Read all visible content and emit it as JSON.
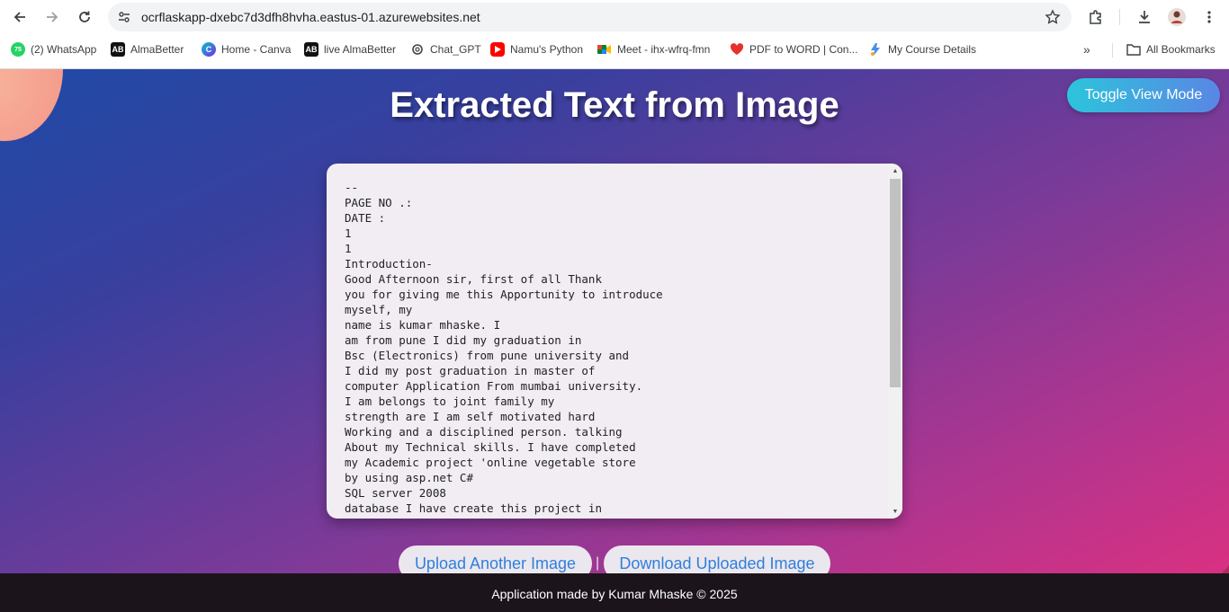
{
  "browser": {
    "url": "ocrflaskapp-dxebc7d3dfh8hvha.eastus-01.azurewebsites.net",
    "bookmarks": [
      {
        "label": "(2) WhatsApp",
        "icon": "whatsapp-icon",
        "badge": "75"
      },
      {
        "label": "AlmaBetter",
        "icon": "almabetter-icon",
        "badge": "AB"
      },
      {
        "label": "Home - Canva",
        "icon": "canva-icon",
        "badge": "C"
      },
      {
        "label": "live AlmaBetter",
        "icon": "almabetter-icon",
        "badge": "AB"
      },
      {
        "label": "Chat_GPT",
        "icon": "chatgpt-icon",
        "badge": ""
      },
      {
        "label": "Namu's Python",
        "icon": "youtube-icon",
        "badge": ""
      },
      {
        "label": "Meet - ihx-wfrq-fmn",
        "icon": "meet-icon",
        "badge": ""
      },
      {
        "label": "PDF to WORD | Con...",
        "icon": "heart-icon",
        "badge": ""
      },
      {
        "label": "My Course Details",
        "icon": "course-icon",
        "badge": ""
      }
    ],
    "all_bookmarks_label": "All Bookmarks"
  },
  "page": {
    "title": "Extracted Text from Image",
    "toggle_label": "Toggle View Mode",
    "extracted_text": "--\nPAGE NO .:\nDATE :\n1\n1\nIntroduction-\nGood Afternoon sir, first of all Thank\nyou for giving me this Apportunity to introduce\nmyself, my\nname is kumar mhaske. I\nam from pune I did my graduation in\nBsc (Electronics) from pune university and\nI did my post graduation in master of\ncomputer Application From mumbai university.\nI am belongs to joint family my\nstrength are I am self motivated hard\nWorking and a disciplined person. talking\nAbout my Technical skills. I have completed\nmy Academic project 'online vegetable store\nby using asp.net C#\nSQL server 2008\ndatabase I have create this project in",
    "upload_label": "Upload Another Image",
    "separator": "|",
    "download_label": "Download Uploaded Image",
    "footer": "Application made by Kumar Mhaske © 2025"
  },
  "colors": {
    "toggle_gradient": [
      "#2cc4dc",
      "#5a86e4"
    ],
    "action_text": "#2f7fdc",
    "footer_bg": "#1c141b"
  }
}
